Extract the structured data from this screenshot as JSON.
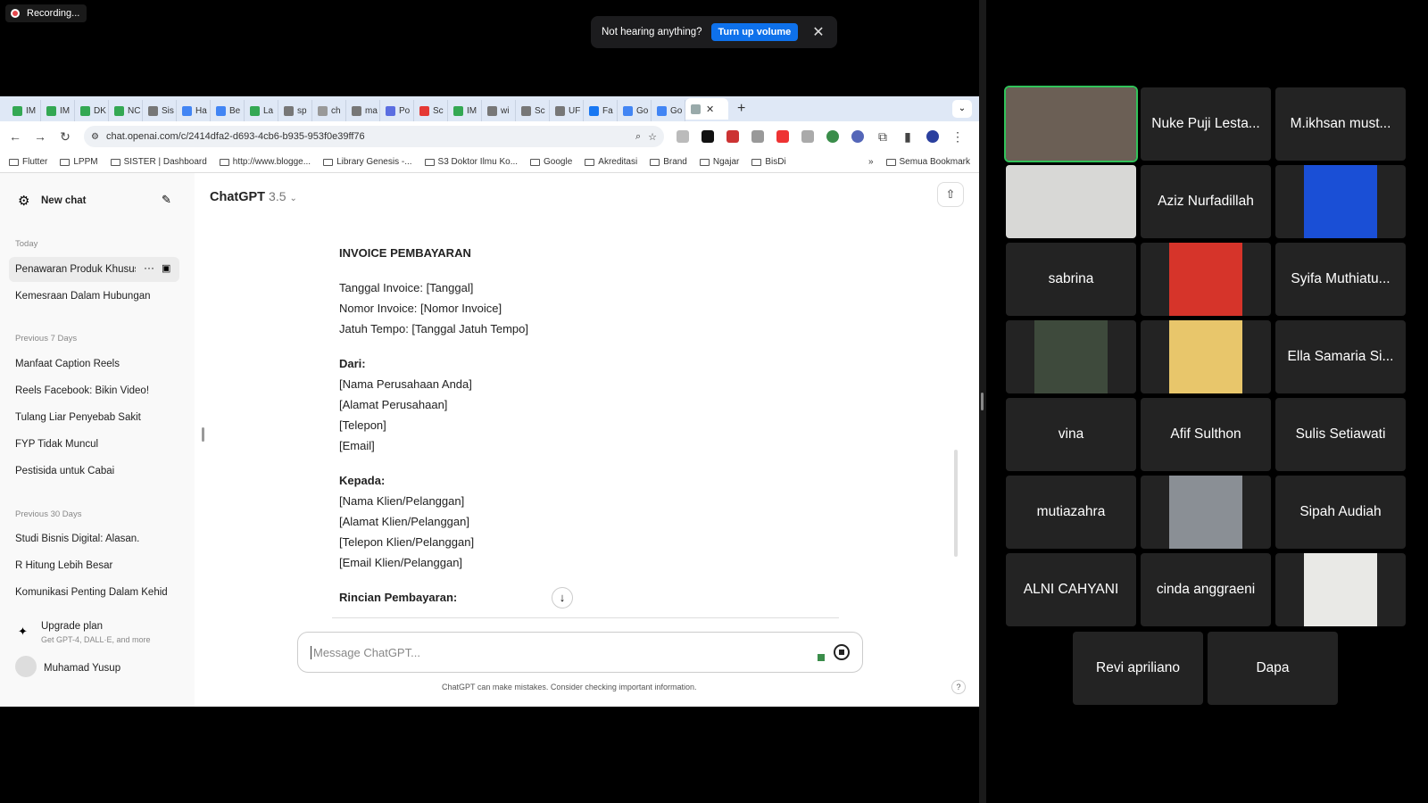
{
  "recording": {
    "label": "Recording..."
  },
  "notification": {
    "text": "Not hearing anything?",
    "button": "Turn up volume"
  },
  "browser": {
    "tabs": [
      {
        "label": "IM",
        "color": "#34a853"
      },
      {
        "label": "IM",
        "color": "#34a853"
      },
      {
        "label": "DK",
        "color": "#34a853"
      },
      {
        "label": "NC",
        "color": "#34a853"
      },
      {
        "label": "Sis",
        "color": "#777"
      },
      {
        "label": "Ha",
        "color": "#4285f4"
      },
      {
        "label": "Be",
        "color": "#4285f4"
      },
      {
        "label": "La",
        "color": "#34a853"
      },
      {
        "label": "sp",
        "color": "#777"
      },
      {
        "label": "ch",
        "color": "#999"
      },
      {
        "label": "ma",
        "color": "#777"
      },
      {
        "label": "Po",
        "color": "#5b6ee1"
      },
      {
        "label": "Sc",
        "color": "#e53935"
      },
      {
        "label": "IM",
        "color": "#34a853"
      },
      {
        "label": "wi",
        "color": "#777"
      },
      {
        "label": "Sc",
        "color": "#777"
      },
      {
        "label": "UF",
        "color": "#777"
      },
      {
        "label": "Fa",
        "color": "#1877f2"
      },
      {
        "label": "Go",
        "color": "#4285f4"
      },
      {
        "label": "Go",
        "color": "#4285f4"
      }
    ],
    "url": "chat.openai.com/c/2414dfa2-d693-4cb6-b935-953f0e39ff76",
    "bookmarks": [
      "Flutter",
      "LPPM",
      "SISTER | Dashboard",
      "http://www.blogge...",
      "Library Genesis -...",
      "S3 Doktor Ilmu Ko...",
      "Google",
      "Akreditasi",
      "Brand",
      "Ngajar",
      "BisDi"
    ],
    "all_bookmarks": "Semua Bookmark"
  },
  "sidebar": {
    "new_chat": "New chat",
    "today_label": "Today",
    "today": [
      "Penawaran Produk Khusus",
      "Kemesraan Dalam Hubungan"
    ],
    "prev7_label": "Previous 7 Days",
    "prev7": [
      "Manfaat Caption Reels",
      "Reels Facebook: Bikin Video!",
      "Tulang Liar Penyebab Sakit",
      "FYP Tidak Muncul",
      "Pestisida untuk Cabai"
    ],
    "prev30_label": "Previous 30 Days",
    "prev30": [
      "Studi Bisnis Digital: Alasan.",
      "R Hitung Lebih Besar",
      "Komunikasi Penting Dalam Kehid"
    ],
    "upgrade_title": "Upgrade plan",
    "upgrade_sub": "Get GPT-4, DALL·E, and more",
    "user": "Muhamad Yusup"
  },
  "chat": {
    "model": "ChatGPT",
    "version": "3.5",
    "title": "INVOICE PEMBAYARAN",
    "invoice_lines": [
      "Tanggal Invoice: [Tanggal]",
      "Nomor Invoice: [Nomor Invoice]",
      "Jatuh Tempo: [Tanggal Jatuh Tempo]"
    ],
    "from_label": "Dari:",
    "from_lines": [
      "[Nama Perusahaan Anda]",
      "[Alamat Perusahaan]",
      "[Telepon]",
      "[Email]"
    ],
    "to_label": "Kepada:",
    "to_lines": [
      "[Nama Klien/Pelanggan]",
      "[Alamat Klien/Pelanggan]",
      "[Telepon Klien/Pelanggan]",
      "[Email Klien/Pelanggan]"
    ],
    "details_label": "Rincian Pembayaran:",
    "placeholder": "Message ChatGPT...",
    "disclaimer": "ChatGPT can make mistakes. Consider checking important information.",
    "help": "?"
  },
  "participants": [
    {
      "name": "",
      "video": true,
      "bg": "#6b5f55",
      "highlight": true
    },
    {
      "name": "Nuke Puji Lesta..."
    },
    {
      "name": "M.ikhsan must..."
    },
    {
      "name": "",
      "video": true,
      "bg": "#d8d8d6"
    },
    {
      "name": "Aziz Nurfadillah"
    },
    {
      "name": "",
      "video": true,
      "bg": "#1a4fd6"
    },
    {
      "name": "sabrina"
    },
    {
      "name": "",
      "video": true,
      "bg": "#d6342a"
    },
    {
      "name": "Syifa Muthiatu..."
    },
    {
      "name": "",
      "video": true,
      "bg": "#3e4a3c"
    },
    {
      "name": "",
      "video": true,
      "bg": "#e8c66b"
    },
    {
      "name": "Ella Samaria Si..."
    },
    {
      "name": "vina"
    },
    {
      "name": "Afif Sulthon"
    },
    {
      "name": "Sulis Setiawati"
    },
    {
      "name": "mutiazahra"
    },
    {
      "name": "",
      "video": true,
      "bg": "#8a8f95"
    },
    {
      "name": "Sipah Audiah"
    },
    {
      "name": "ALNI CAHYANI"
    },
    {
      "name": "cinda anggraeni"
    },
    {
      "name": "",
      "video": true,
      "bg": "#e9e9e6"
    },
    {
      "name": "Revi apriliano"
    },
    {
      "name": "Dapa"
    }
  ]
}
